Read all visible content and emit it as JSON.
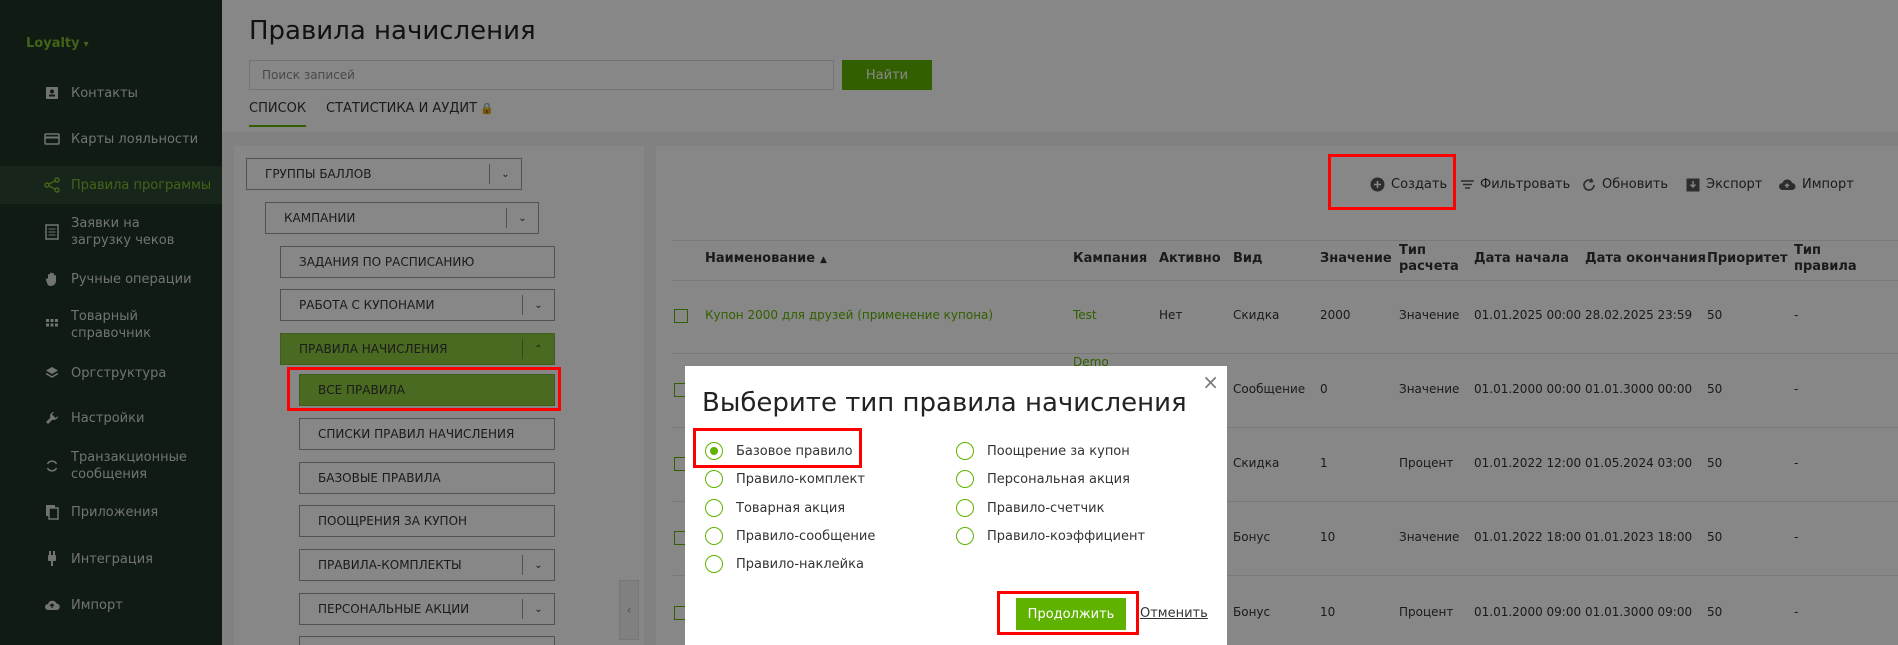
{
  "app": {
    "name": "Loyalty"
  },
  "sidebar": {
    "items": [
      {
        "label": "Контакты",
        "icon": "contact-card-icon"
      },
      {
        "label": "Карты лояльности",
        "icon": "credit-card-icon"
      },
      {
        "label": "Правила программы",
        "icon": "share-nodes-icon",
        "active": true
      },
      {
        "label": "Заявки на загрузку чеков",
        "icon": "receipt-list-icon"
      },
      {
        "label": "Ручные операции",
        "icon": "hand-icon"
      },
      {
        "label": "Товарный справочник",
        "icon": "grid-icon"
      },
      {
        "label": "Оргструктура",
        "icon": "layers-icon"
      },
      {
        "label": "Настройки",
        "icon": "wrench-icon"
      },
      {
        "label": "Транзакционные сообщения",
        "icon": "sync-icon"
      },
      {
        "label": "Приложения",
        "icon": "copy-icon"
      },
      {
        "label": "Интеграция",
        "icon": "plug-icon"
      },
      {
        "label": "Импорт",
        "icon": "cloud-upload-icon"
      }
    ]
  },
  "header": {
    "title": "Правила начисления",
    "search": {
      "placeholder": "Поиск записей",
      "button": "Найти"
    },
    "tabs": [
      {
        "label": "СПИСОК",
        "active": true
      },
      {
        "label": "СТАТИСТИКА И АУДИТ",
        "locked": true
      }
    ]
  },
  "tree": {
    "nodes": [
      {
        "label": "ГРУППЫ БАЛЛОВ"
      },
      {
        "label": "КАМПАНИИ"
      },
      {
        "label": "ЗАДАНИЯ ПО РАСПИСАНИЮ"
      },
      {
        "label": "РАБОТА С КУПОНАМИ"
      },
      {
        "label": "ПРАВИЛА НАЧИСЛЕНИЯ",
        "expanded": true
      },
      {
        "label": "ВСЕ ПРАВИЛА",
        "selected": true
      },
      {
        "label": "СПИСКИ ПРАВИЛ НАЧИСЛЕНИЯ"
      },
      {
        "label": "БАЗОВЫЕ ПРАВИЛА"
      },
      {
        "label": "ПООЩРЕНИЯ ЗА КУПОН"
      },
      {
        "label": "ПРАВИЛА-КОМПЛЕКТЫ"
      },
      {
        "label": "ПЕРСОНАЛЬНЫЕ АКЦИИ"
      }
    ]
  },
  "toolbar": {
    "create": "Создать",
    "filter": "Фильтровать",
    "refresh": "Обновить",
    "export": "Экспорт",
    "import": "Импорт"
  },
  "table": {
    "headers": {
      "name": "Наименование",
      "campaign": "Кампания",
      "active": "Активно",
      "kind": "Вид",
      "value": "Значение",
      "calc_type": "Тип расчета",
      "start": "Дата начала",
      "end": "Дата окончания",
      "priority": "Приоритет",
      "rule_type": "Тип правила"
    },
    "rows": [
      {
        "name": "Купон 2000 для друзей (применение купона)",
        "campaign": "Test",
        "active": "Нет",
        "kind": "Скидка",
        "value": "2000",
        "calc": "Значение",
        "start": "01.01.2025 00:00",
        "end": "28.02.2025 23:59",
        "priority": "50",
        "rule_type": "-"
      },
      {
        "campaign": "Demo",
        "kind": "Сообщение",
        "value": "0",
        "calc": "Значение",
        "start": "01.01.2000 00:00",
        "end": "01.01.3000 00:00",
        "priority": "50",
        "rule_type": "-"
      },
      {
        "kind": "Скидка",
        "value": "1",
        "calc": "Процент",
        "start": "01.01.2022 12:00",
        "end": "01.05.2024 03:00",
        "priority": "50",
        "rule_type": "-"
      },
      {
        "kind": "Бонус",
        "value": "10",
        "calc": "Значение",
        "start": "01.01.2022 18:00",
        "end": "01.01.2023 18:00",
        "priority": "50",
        "rule_type": "-"
      },
      {
        "kind": "Бонус",
        "value": "10",
        "calc": "Процент",
        "start": "01.01.2000 09:00",
        "end": "01.01.3000 09:00",
        "priority": "50",
        "rule_type": "-"
      }
    ]
  },
  "modal": {
    "title": "Выберите тип правила начисления",
    "close": "×",
    "options_left": [
      {
        "label": "Базовое правило",
        "checked": true
      },
      {
        "label": "Правило-комплект"
      },
      {
        "label": "Товарная акция"
      },
      {
        "label": "Правило-сообщение"
      },
      {
        "label": "Правило-наклейка"
      }
    ],
    "options_right": [
      {
        "label": "Поощрение за купон"
      },
      {
        "label": "Персональная акция"
      },
      {
        "label": "Правило-счетчик"
      },
      {
        "label": "Правило-коэффициент"
      }
    ],
    "continue": "Продолжить",
    "cancel": "Отменить"
  },
  "colors": {
    "accent": "#5fb300",
    "sidebar": "#1f3327",
    "highlight": "#ff0000"
  }
}
